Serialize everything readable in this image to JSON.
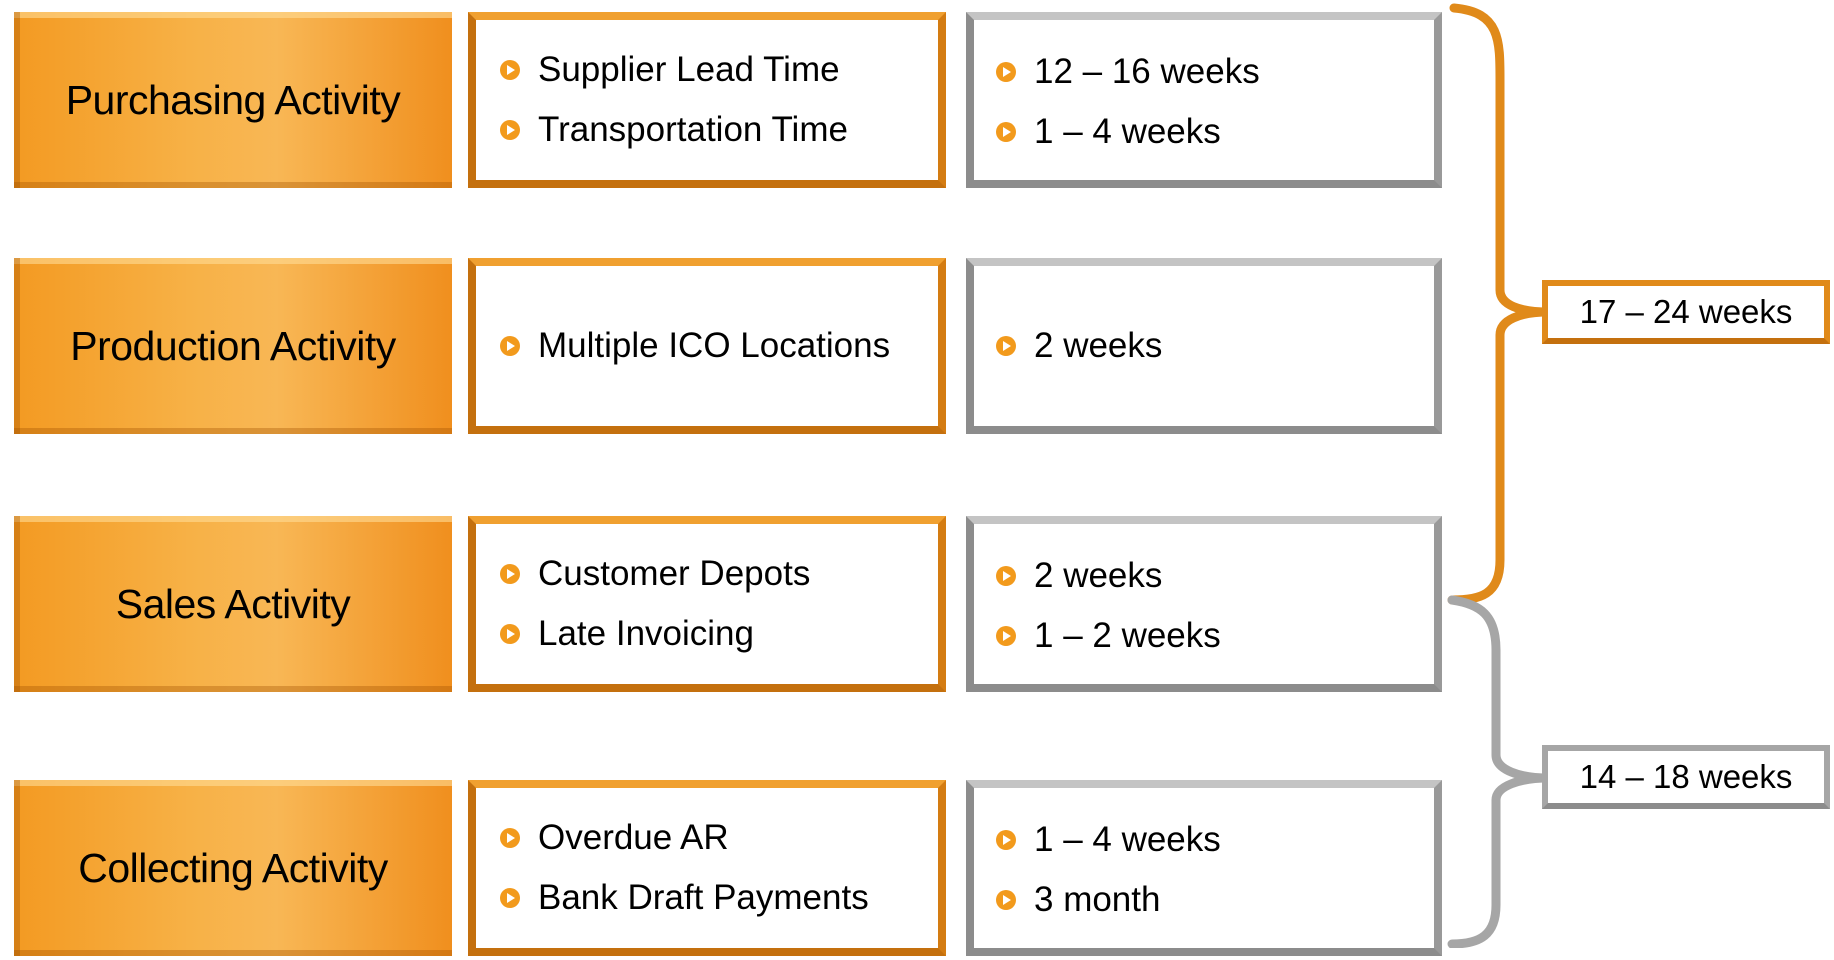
{
  "rows": [
    {
      "activity": "Purchasing Activity",
      "factors": [
        "Supplier Lead Time",
        "Transportation Time"
      ],
      "durations": [
        "12 – 16 weeks",
        "1 – 4 weeks"
      ]
    },
    {
      "activity": "Production Activity",
      "factors": [
        "Multiple ICO Locations"
      ],
      "durations": [
        "2 weeks"
      ]
    },
    {
      "activity": "Sales Activity",
      "factors": [
        "Customer Depots",
        "Late Invoicing"
      ],
      "durations": [
        "2 weeks",
        "1 – 2 weeks"
      ]
    },
    {
      "activity": "Collecting Activity",
      "factors": [
        "Overdue AR",
        "Bank Draft Payments"
      ],
      "durations": [
        "1 – 4 weeks",
        "3 month"
      ]
    }
  ],
  "totals": {
    "upper": "17 – 24 weeks",
    "lower": "14 – 18 weeks"
  },
  "colors": {
    "orange": "#f39a22",
    "gray": "#a6a6a6",
    "bullet": "#f29a1c"
  }
}
